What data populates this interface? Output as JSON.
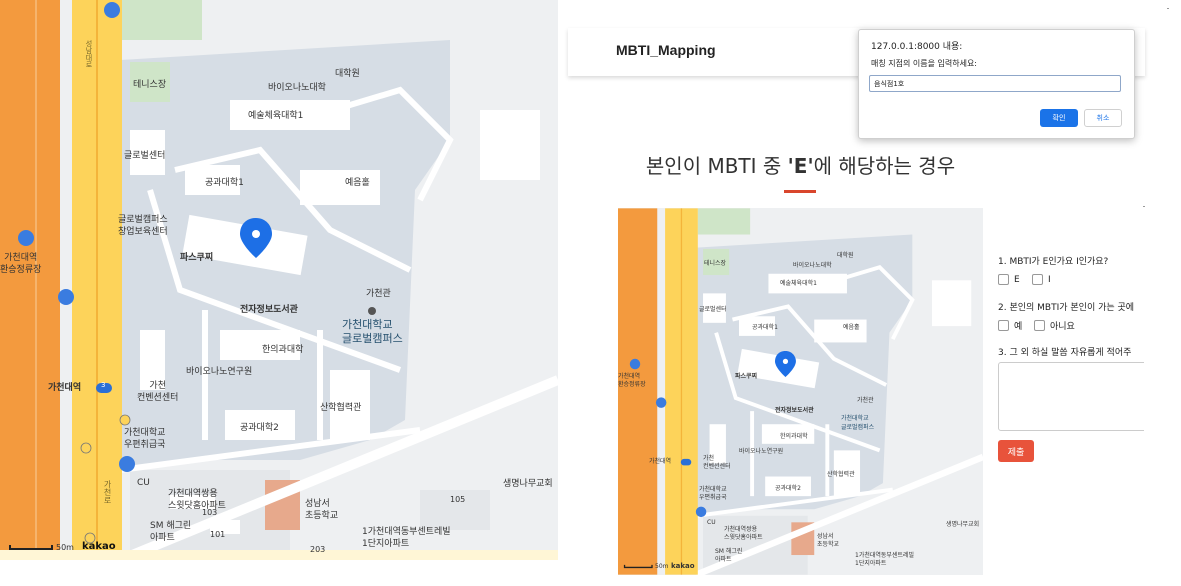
{
  "map": {
    "labels": {
      "tennis": "테니스장",
      "bio_lab": "바이오나노대학",
      "grad_school": "대학원",
      "arts_sports": "예술체육대학1",
      "global_center": "글로벌센터",
      "eng1": "공과대학1",
      "yeeum": "예음홀",
      "global_startup": "글로벌캠퍼스\n창업보육센터",
      "pascucci": "파스쿠찌",
      "elec_library": "전자정보도서관",
      "gachongwan": "가천관",
      "gachon_univ_campus": "가천대학교\n글로벌캠퍼스",
      "oriental_medicine": "한의과대학",
      "bio_nano_inst": "바이오나노연구원",
      "convention": "가천\n컨벤션센터",
      "industry": "산학협력관",
      "eng2": "공과대학2",
      "post_office": "가천대학교\n우편취급국",
      "cu": "CU",
      "apt1": "가천대역쌍용\n스윗닷홈아파트",
      "apt2": "SM 해그린\n아파트",
      "elementary": "성남서\n초등학교",
      "tree_church": "생명나무교회",
      "center_apt": "1가천대역동부센트레빌\n1단지아파트",
      "transfer_station": "가천대역\n환승정류장",
      "gachon_station": "가천대역",
      "road_name_1": "성남대로",
      "road_name_2": "가천로",
      "subway_line": "3",
      "scale": "50m",
      "kakao": "kakao",
      "bldg_num_101": "101",
      "bldg_num_103": "103",
      "bldg_num_105": "105",
      "bldg_num_203": "203"
    },
    "colors": {
      "highway": "#f39a3e",
      "mainroad": "#fdd35a",
      "campus": "#d6dde5",
      "building": "#ffffff",
      "green": "#cfe5c8",
      "marker": "#1d6fe6"
    }
  },
  "navbar": {
    "brand": "MBTI_Mapping"
  },
  "dialog": {
    "title": "127.0.0.1:8000 내용:",
    "message": "매칭 지점의 이름을 입력하세요:",
    "input_value": "음식점1호",
    "ok_label": "확인",
    "cancel_label": "취소"
  },
  "heading": {
    "prefix": "본인이 MBTI 중 ",
    "highlight": "'E'",
    "suffix": "에 해당하는 경우"
  },
  "form": {
    "q1": "1. MBTI가 E인가요 I인가요?",
    "q1_opt1": "E",
    "q1_opt2": "I",
    "q2": "2. 본인의 MBTI가 본인이 가는 곳에",
    "q2_opt1": "예",
    "q2_opt2": "아니요",
    "q3": "3. 그 외 하실 말씀 자유롭게 적어주",
    "submit_label": "제출"
  }
}
